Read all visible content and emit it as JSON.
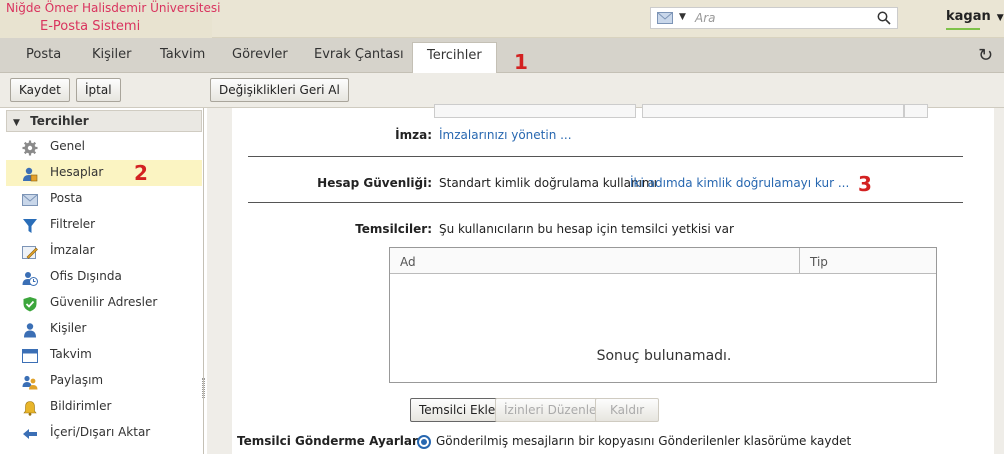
{
  "header": {
    "logo_line1": "Niğde Ömer Halisdemir Üniversitesi",
    "logo_line2": "E-Posta Sistemi",
    "search_placeholder": "Ara",
    "username": "kagan"
  },
  "tabs": [
    {
      "label": "Posta"
    },
    {
      "label": "Kişiler"
    },
    {
      "label": "Takvim"
    },
    {
      "label": "Görevler"
    },
    {
      "label": "Evrak Çantası"
    },
    {
      "label": "Tercihler",
      "active": true
    }
  ],
  "annotations": [
    "1",
    "2",
    "3"
  ],
  "toolbar": {
    "save_label": "Kaydet",
    "cancel_label": "İptal",
    "revert_label": "Değişiklikleri Geri Al"
  },
  "sidebar": {
    "header": "Tercihler",
    "items": [
      {
        "label": "Genel",
        "icon": "gear-icon"
      },
      {
        "label": "Hesaplar",
        "icon": "accounts-icon",
        "selected": true
      },
      {
        "label": "Posta",
        "icon": "mail-icon"
      },
      {
        "label": "Filtreler",
        "icon": "filter-icon"
      },
      {
        "label": "İmzalar",
        "icon": "signature-icon"
      },
      {
        "label": "Ofis Dışında",
        "icon": "out-of-office-icon"
      },
      {
        "label": "Güvenilir Adresler",
        "icon": "shield-icon"
      },
      {
        "label": "Kişiler",
        "icon": "contacts-icon"
      },
      {
        "label": "Takvim",
        "icon": "calendar-icon"
      },
      {
        "label": "Paylaşım",
        "icon": "sharing-icon"
      },
      {
        "label": "Bildirimler",
        "icon": "bell-icon"
      },
      {
        "label": "İçeri/Dışarı Aktar",
        "icon": "import-export-icon"
      }
    ]
  },
  "main": {
    "signature_label": "İmza:",
    "signature_link": "İmzalarınızı yönetin ...",
    "security_label": "Hesap Güvenliği:",
    "security_text": "Standart kimlik doğrulama kullanımı",
    "security_link": "İki adımda kimlik doğrulamayı kur ...",
    "delegates_label": "Temsilciler:",
    "delegates_text": "Şu kullanıcıların bu hesap için temsilci yetkisi var",
    "table_headers": [
      "Ad",
      "Tip"
    ],
    "table_empty": "Sonuç bulunamadı.",
    "add_delegate": "Temsilci Ekle",
    "edit_permissions": "İzinleri Düzenle",
    "remove": "Kaldır",
    "delegate_send_label": "Temsilci Gönderme Ayarları:",
    "delegate_send_option": "Gönderilmiş mesajların bir kopyasını Gönderilenler klasörüme kaydet"
  },
  "colors": {
    "accent": "#2767b0",
    "brand": "#d9335e",
    "annotation": "#d32121",
    "selection": "#fbf4c2"
  }
}
